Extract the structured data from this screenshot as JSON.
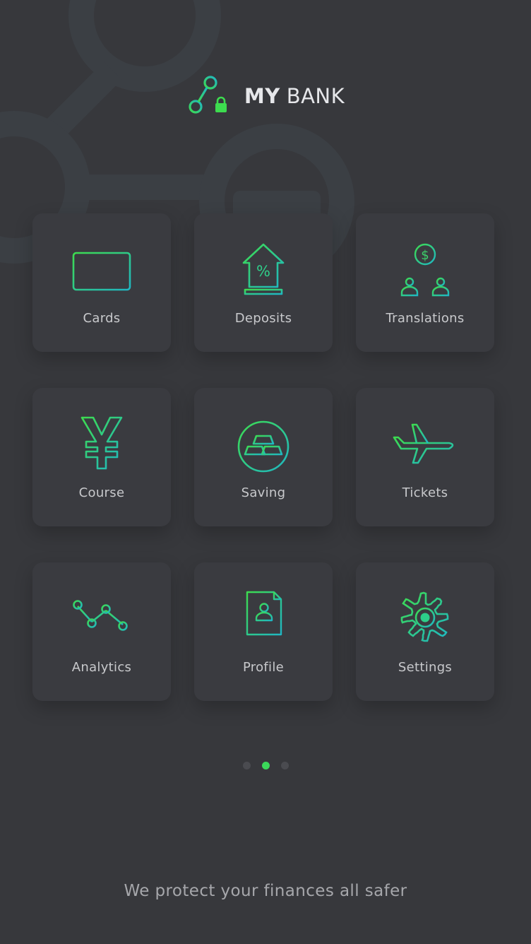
{
  "app": {
    "brand_strong": "MY",
    "brand_light": "BANK",
    "accent_from": "#3ddc4f",
    "accent_to": "#1fb7c4"
  },
  "menu": [
    {
      "label": "Cards",
      "icon": "credit-card-icon"
    },
    {
      "label": "Deposits",
      "icon": "percent-house-icon"
    },
    {
      "label": "Translations",
      "icon": "transfer-tree-icon"
    },
    {
      "label": "Course",
      "icon": "yen-icon"
    },
    {
      "label": "Saving",
      "icon": "gold-bars-icon"
    },
    {
      "label": "Tickets",
      "icon": "airplane-icon"
    },
    {
      "label": "Analytics",
      "icon": "line-chart-icon"
    },
    {
      "label": "Profile",
      "icon": "profile-document-icon"
    },
    {
      "label": "Settings",
      "icon": "gear-icon"
    }
  ],
  "pagination": {
    "pages": 3,
    "current": 2
  },
  "footer": {
    "tagline": "We protect your finances all safer"
  }
}
